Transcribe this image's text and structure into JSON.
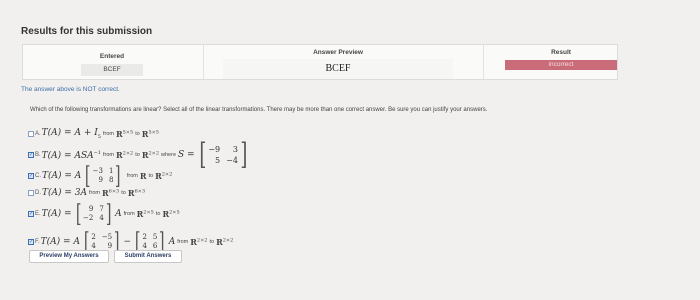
{
  "page": {
    "heading": "Results for this submission"
  },
  "results": {
    "entered_header": "Entered",
    "entered_value": "BCEF",
    "preview_header": "Answer Preview",
    "preview_value": "BCEF",
    "result_header": "Result",
    "result_value": "incorrect",
    "result_color": "#c96b78"
  },
  "status_text": "The answer above is NOT correct.",
  "question_text": "Which of the following transformations are linear? Select all of the linear transformations. There may be more than one correct answer. Be sure you can justify your answers.",
  "options": [
    {
      "letter": "A.",
      "checked": false,
      "expr": "T(A) = A + I",
      "sub": "5",
      "from_word": "from",
      "from_space": "R",
      "from_exp": "5×5",
      "to_word": "to",
      "to_space": "R",
      "to_exp": "5×5"
    },
    {
      "letter": "B.",
      "checked": true,
      "expr": "T(A) = ASA",
      "exp": "−1",
      "from_word": "from",
      "from_space": "R",
      "from_exp": "2×2",
      "to_word": "to",
      "to_space": "R",
      "to_exp": "2×2",
      "where_text": "where",
      "s_label": "S =",
      "matrix": [
        "−9",
        "3",
        "5",
        "−4"
      ]
    },
    {
      "letter": "C.",
      "checked": true,
      "expr": "T(A) = A",
      "matrix": [
        "−3",
        "1",
        "9",
        "8"
      ],
      "from_word": "from",
      "from_space": "R",
      "to_word": "to",
      "to_space": "R",
      "to_exp": "2×2"
    },
    {
      "letter": "D.",
      "checked": false,
      "expr": "T(A) = 3A",
      "from_word": "from",
      "from_space": "R",
      "from_exp": "6×3",
      "to_word": "to",
      "to_space": "R",
      "to_exp": "6×3"
    },
    {
      "letter": "E.",
      "checked": true,
      "expr": "T(A) =",
      "matrix": [
        "9",
        "7",
        "−2",
        "4"
      ],
      "tail": "A",
      "from_word": "from",
      "from_space": "R",
      "from_exp": "2×5",
      "to_word": "to",
      "to_space": "R",
      "to_exp": "2×5"
    },
    {
      "letter": "F.",
      "checked": true,
      "expr": "T(A) = A",
      "matrix": [
        "2",
        "−5",
        "4",
        "9"
      ],
      "minus": "−",
      "matrix2": [
        "2",
        "5",
        "4",
        "6"
      ],
      "tail": "A",
      "from_word": "from",
      "from_space": "R",
      "from_exp": "2×2",
      "to_word": "to",
      "to_space": "R",
      "to_exp": "2×2"
    }
  ],
  "buttons": {
    "preview": "Preview My Answers",
    "submit": "Submit Answers"
  }
}
